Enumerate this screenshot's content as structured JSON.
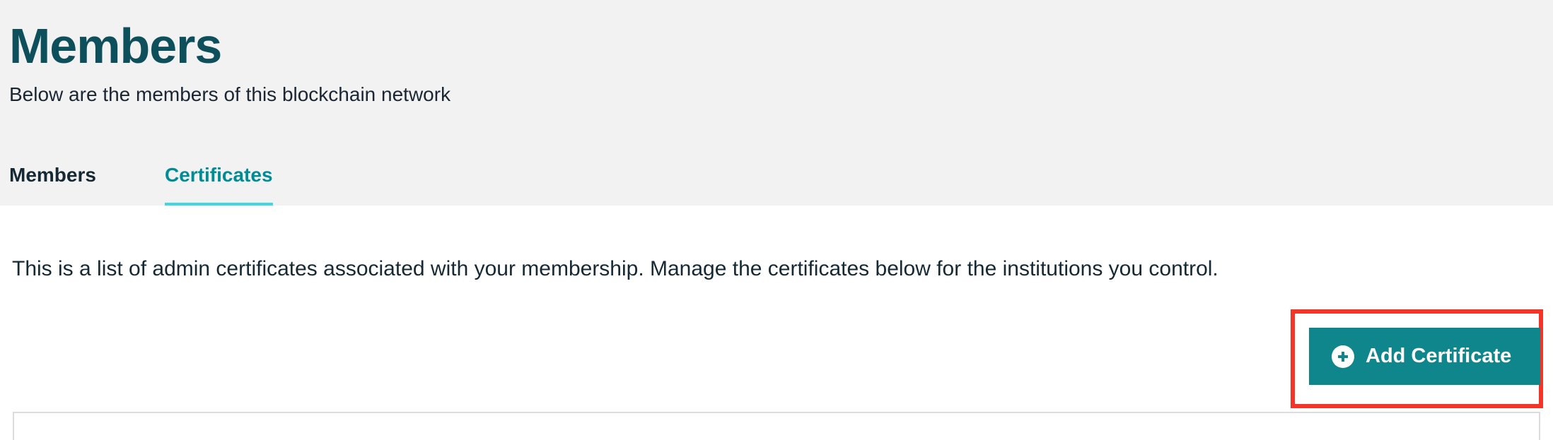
{
  "header": {
    "title": "Members",
    "subtitle": "Below are the members of this blockchain network"
  },
  "tabs": [
    {
      "label": "Members",
      "selected": false
    },
    {
      "label": "Certificates",
      "selected": true
    }
  ],
  "main": {
    "description": "This is a list of admin certificates associated with your membership. Manage the certificates below for the institutions you control.",
    "add_button": {
      "label": "Add Certificate",
      "icon": "plus-circle-icon"
    }
  },
  "colors": {
    "title": "#0e4f5c",
    "accent": "#008c95",
    "tab_underline": "#41d6e3",
    "button_bg": "#0f858c",
    "highlight": "#f23526",
    "header_bg": "#f2f2f2"
  }
}
